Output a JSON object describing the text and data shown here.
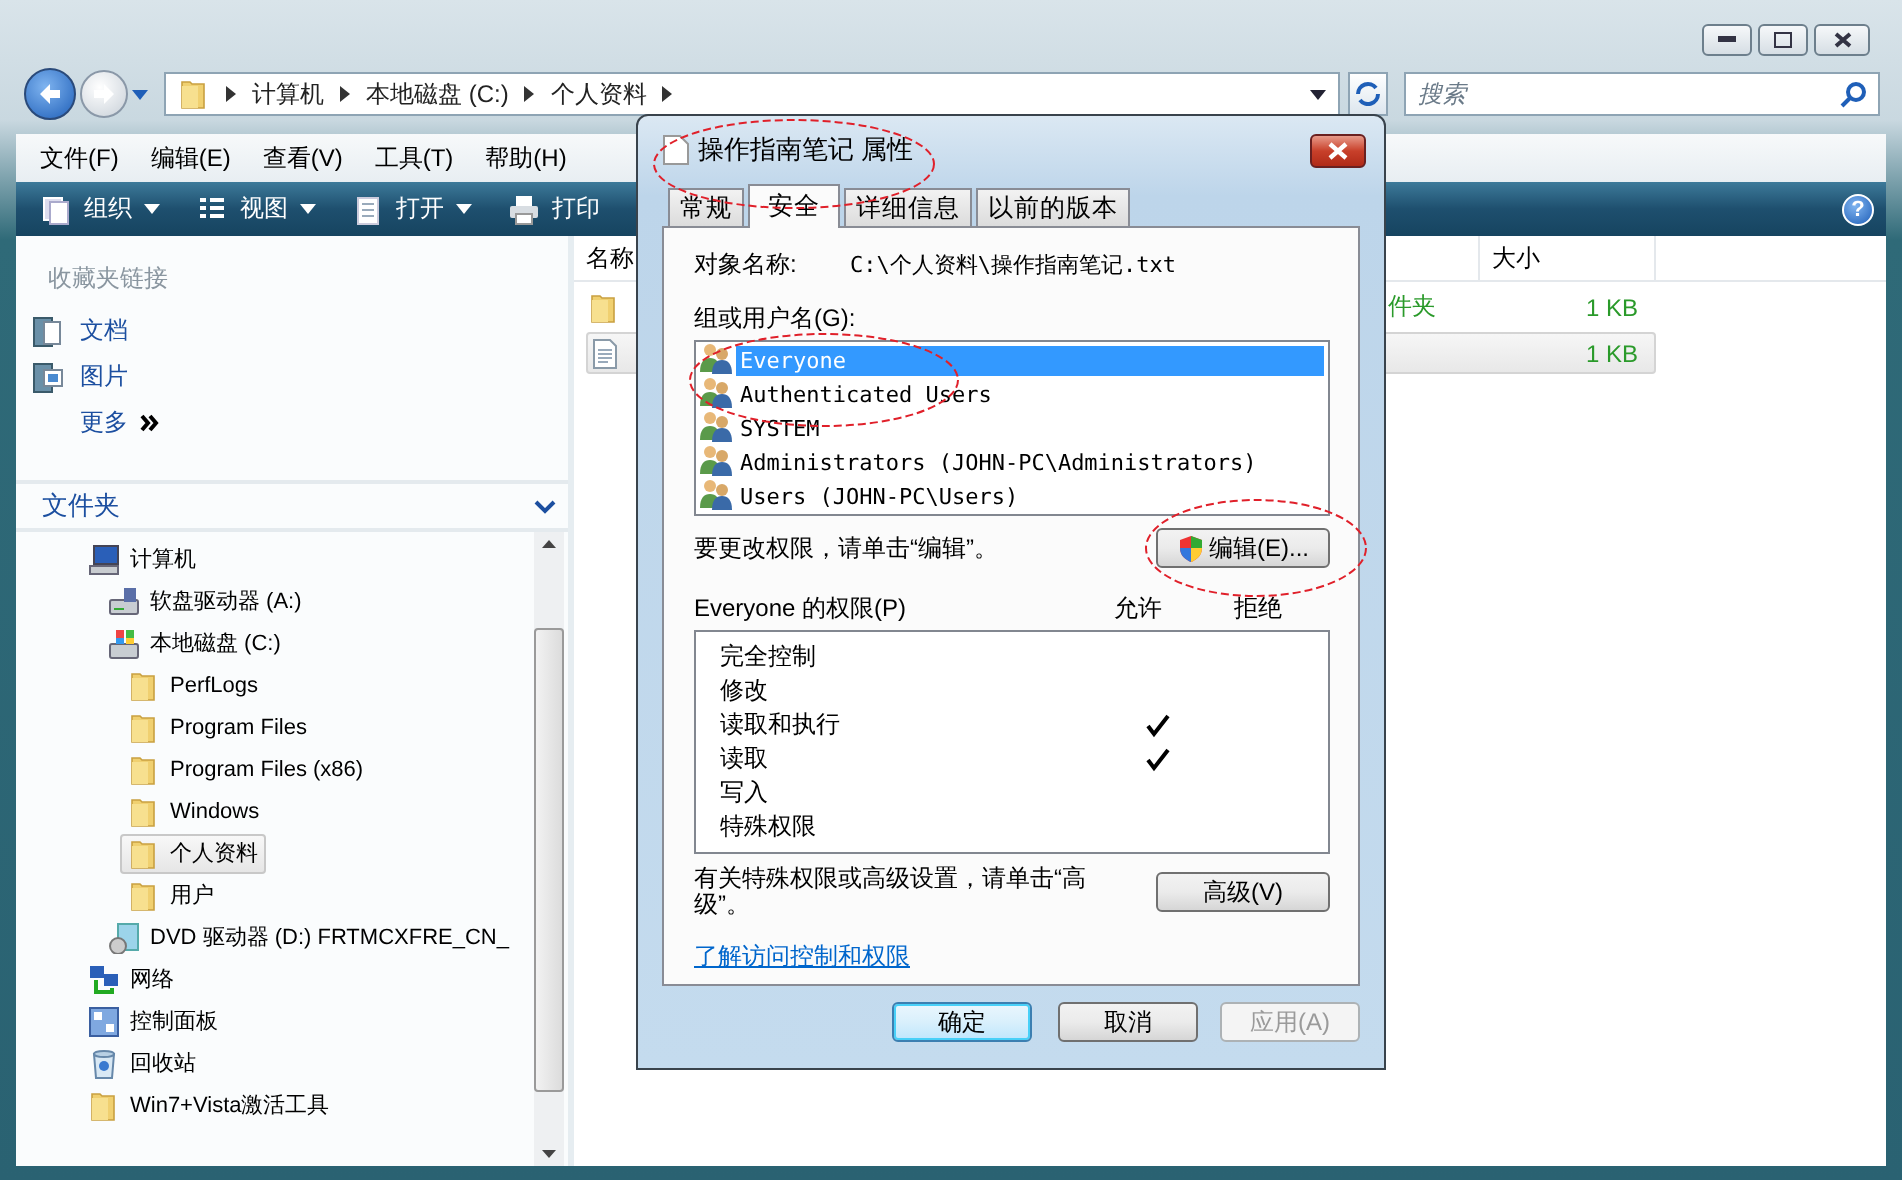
{
  "address_bar": {
    "path": [
      "计算机",
      "本地磁盘 (C:)",
      "个人资料"
    ]
  },
  "search": {
    "placeholder": "搜索"
  },
  "menu": [
    "文件(F)",
    "编辑(E)",
    "查看(V)",
    "工具(T)",
    "帮助(H)"
  ],
  "toolbar": [
    {
      "label": "组织",
      "kind": "organize",
      "dropdown": true
    },
    {
      "label": "视图",
      "kind": "views",
      "dropdown": true
    },
    {
      "label": "打开",
      "kind": "open",
      "dropdown": true
    },
    {
      "label": "打印",
      "kind": "print",
      "dropdown": false
    }
  ],
  "help": "?",
  "favorites": {
    "title": "收藏夹链接",
    "items": [
      {
        "label": "文档",
        "kind": "documents"
      },
      {
        "label": "图片",
        "kind": "pictures"
      }
    ],
    "more": "更多"
  },
  "folders": {
    "title": "文件夹",
    "tree": [
      {
        "label": "计算机",
        "kind": "computer",
        "selected": false,
        "children": [
          {
            "label": "软盘驱动器 (A:)",
            "kind": "floppy",
            "selected": false
          },
          {
            "label": "本地磁盘 (C:)",
            "kind": "drive",
            "selected": false,
            "children": [
              {
                "label": "PerfLogs",
                "kind": "folder",
                "selected": false
              },
              {
                "label": "Program Files",
                "kind": "folder",
                "selected": false
              },
              {
                "label": "Program Files (x86)",
                "kind": "folder",
                "selected": false
              },
              {
                "label": "Windows",
                "kind": "folder",
                "selected": false
              },
              {
                "label": "个人资料",
                "kind": "folder",
                "selected": true
              },
              {
                "label": "用户",
                "kind": "folder",
                "selected": false
              }
            ]
          },
          {
            "label": "DVD 驱动器 (D:) FRTMCXFRE_CN_",
            "kind": "dvd",
            "selected": false
          }
        ]
      },
      {
        "label": "网络",
        "kind": "network",
        "selected": false
      },
      {
        "label": "控制面板",
        "kind": "control-panel",
        "selected": false
      },
      {
        "label": "回收站",
        "kind": "recycle-bin",
        "selected": false
      },
      {
        "label": "Win7+Vista激活工具",
        "kind": "folder",
        "selected": false
      }
    ]
  },
  "file_list": {
    "columns": [
      {
        "label": "名称"
      },
      {
        "label": "大小"
      }
    ],
    "rows": [
      {
        "kind": "folder",
        "column_3": "件夹",
        "size": "1 KB",
        "selected": false
      },
      {
        "kind": "text-file",
        "size": "1 KB",
        "selected": true
      }
    ]
  },
  "dialog": {
    "title": "操作指南笔记 属性",
    "tabs": [
      {
        "label": "常规",
        "selected": false
      },
      {
        "label": "安全",
        "selected": true
      },
      {
        "label": "详细信息",
        "selected": false
      },
      {
        "label": "以前的版本",
        "selected": false
      }
    ],
    "object_label": "对象名称:",
    "object_value": "C:\\个人资料\\操作指南笔记.txt",
    "groups_label": "组或用户名(G):",
    "groups": [
      {
        "name": "Everyone",
        "selected": true
      },
      {
        "name": "Authenticated Users",
        "selected": false
      },
      {
        "name": "SYSTEM",
        "selected": false
      },
      {
        "name": "Administrators (JOHN-PC\\Administrators)",
        "selected": false
      },
      {
        "name": "Users (JOHN-PC\\Users)",
        "selected": false
      }
    ],
    "change_hint": "要更改权限，请单击“编辑”。",
    "edit_button": "编辑(E)...",
    "permissions_label": "Everyone 的权限(P)",
    "allow_header": "允许",
    "deny_header": "拒绝",
    "permissions": [
      {
        "name": "完全控制",
        "allow": false,
        "deny": false
      },
      {
        "name": "修改",
        "allow": false,
        "deny": false
      },
      {
        "name": "读取和执行",
        "allow": true,
        "deny": false
      },
      {
        "name": "读取",
        "allow": true,
        "deny": false
      },
      {
        "name": "写入",
        "allow": false,
        "deny": false
      },
      {
        "name": "特殊权限",
        "allow": false,
        "deny": false
      }
    ],
    "advanced_hint": "有关特殊权限或高级设置，请单击“高级”。",
    "advanced_button": "高级(V)",
    "link": "了解访问控制和权限",
    "buttons": [
      {
        "label": "确定",
        "default": true,
        "disabled": false
      },
      {
        "label": "取消",
        "default": false,
        "disabled": false
      },
      {
        "label": "应用(A)",
        "default": false,
        "disabled": true
      }
    ]
  },
  "annotation_rings": [
    {
      "kind": "ellipse"
    },
    {
      "kind": "ellipse"
    },
    {
      "kind": "ellipse"
    }
  ]
}
